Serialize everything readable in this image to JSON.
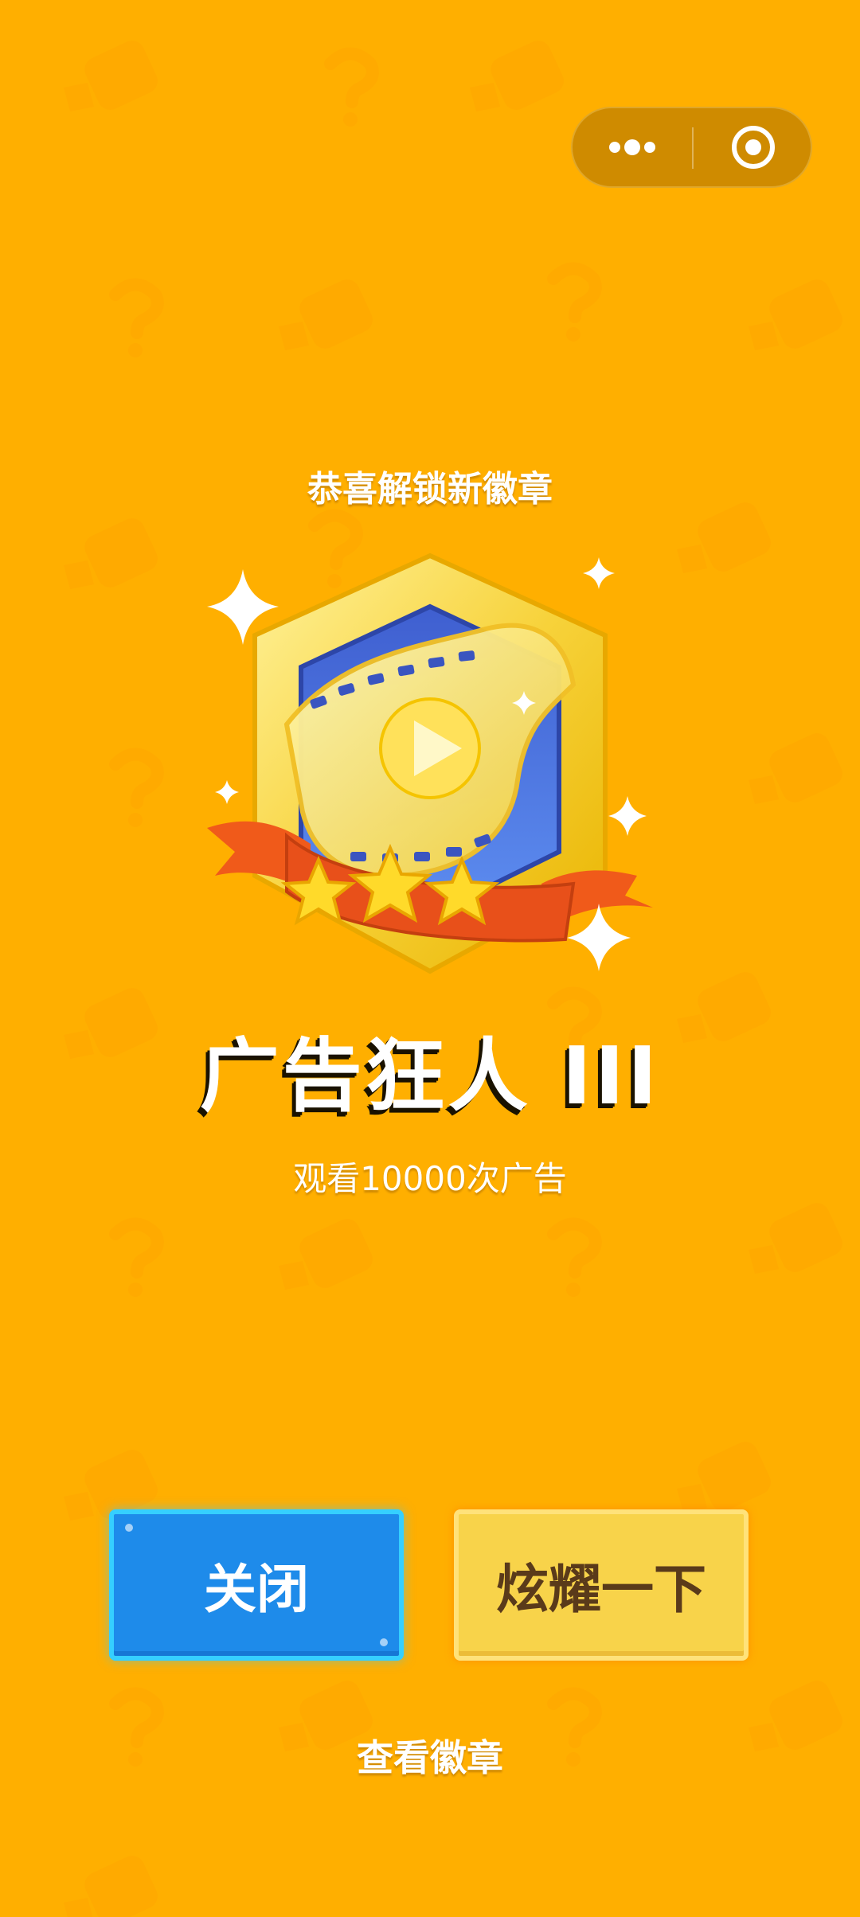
{
  "capsule": {
    "more_icon": "more-dots-icon",
    "close_icon": "target-circle-icon"
  },
  "header": {
    "subtitle": "恭喜解锁新徽章"
  },
  "badge": {
    "name": "广告狂人 III",
    "description": "观看10000次广告",
    "stars": 3,
    "icon": "film-play-badge"
  },
  "buttons": {
    "close_label": "关闭",
    "show_label": "炫耀一下"
  },
  "footer": {
    "view_badges_label": "查看徽章"
  },
  "colors": {
    "background": "#FFAF00",
    "close_button": "#1E8BEA",
    "show_button": "#F8D34A"
  }
}
